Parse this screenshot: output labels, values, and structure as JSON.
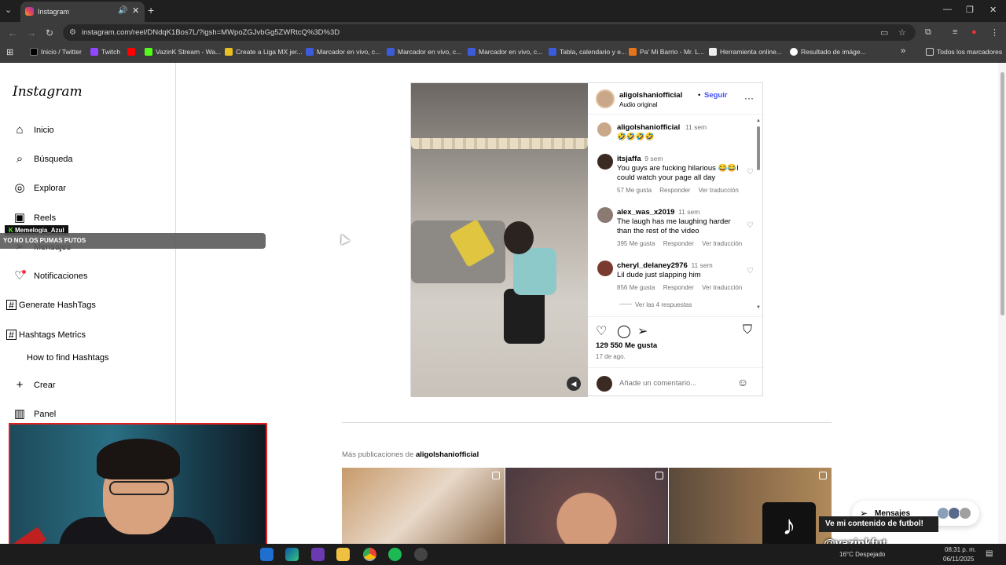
{
  "browser": {
    "tab_title": "Instagram",
    "url": "instagram.com/reel/DNdqK1Bos7L/?igsh=MWpoZGJvbGg5ZWRtcQ%3D%3D",
    "bookmarks": [
      "Inicio / Twitter",
      "Twitch",
      "",
      "VazinK Stream - Wa...",
      "Create a Liga MX jer...",
      "Marcador en vivo, c...",
      "Marcador en vivo, c...",
      "Marcador en vivo, c...",
      "Tabla, calendario y e...",
      "Pa' Mi Barrio - Mr. L...",
      "Herramienta online...",
      "Resultado de imáge..."
    ],
    "all_bookmarks": "Todos los marcadores"
  },
  "sidebar": {
    "logo": "Instagram",
    "items": [
      {
        "label": "Inicio",
        "icon": "home-icon"
      },
      {
        "label": "Búsqueda",
        "icon": "search-icon"
      },
      {
        "label": "Explorar",
        "icon": "compass-icon"
      },
      {
        "label": "Reels",
        "icon": "reels-icon"
      },
      {
        "label": "Mensajes",
        "icon": "messenger-icon"
      },
      {
        "label": "Notificaciones",
        "icon": "heart-icon"
      },
      {
        "label": "Generate HashTags",
        "icon": "hashtag-icon"
      },
      {
        "label": "Hashtags Metrics",
        "icon": "hashtag-icon"
      },
      {
        "label": "How to find Hashtags",
        "icon": ""
      },
      {
        "label": "Crear",
        "icon": "plus-icon"
      },
      {
        "label": "Panel",
        "icon": "chart-icon"
      }
    ]
  },
  "overlay": {
    "alert_user": "Memelogia_Azul",
    "alert_text": "YO NO LOS PUMAS PUTOS"
  },
  "post": {
    "author": "aligolshaniofficial",
    "follow": "Seguir",
    "audio": "Audio original",
    "caption": {
      "user": "aligolshaniofficial",
      "time": "11 sem",
      "text": "🤣🤣🤣🤣"
    },
    "comments": [
      {
        "user": "itsjaffa",
        "time": "9 sem",
        "text": "You guys are fucking hilarious 😂😂I could watch your page all day",
        "likes": "57 Me gusta",
        "reply": "Responder",
        "translate": "Ver traducción"
      },
      {
        "user": "alex_was_x2019",
        "time": "11 sem",
        "text": "The laugh has me laughing harder than the rest of the video",
        "likes": "395 Me gusta",
        "reply": "Responder",
        "translate": "Ver traducción"
      },
      {
        "user": "cheryl_delaney2976",
        "time": "11 sem",
        "text": "Lil dude just slapping him",
        "likes": "856 Me gusta",
        "reply": "Responder",
        "translate": "Ver traducción"
      }
    ],
    "view_replies": "Ver las 4 respuestas",
    "like_count": "129 550 Me gusta",
    "date": "17 de ago.",
    "comment_placeholder": "Añade un comentario..."
  },
  "more": {
    "prefix": "Más publicaciones de",
    "user": "aligolshaniofficial"
  },
  "messages_pill": "Mensajes",
  "tiktok": {
    "banner": "Ve mi contenido de futbol!",
    "handle": "@vazinkfut"
  },
  "taskbar": {
    "weather": "16°C  Despejado",
    "time": "08:31 p. m.",
    "date": "06/11/2025"
  }
}
